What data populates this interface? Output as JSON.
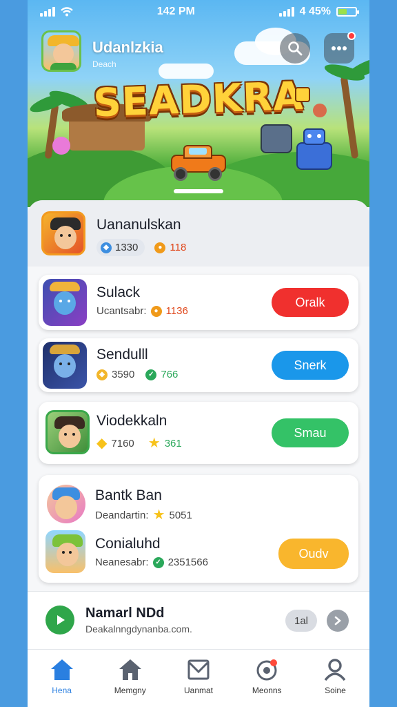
{
  "status_bar": {
    "time": "142 PM",
    "battery": "4 45%",
    "battery_level": 0.45
  },
  "header": {
    "name": "Udanlzkia",
    "subtitle": "Deach"
  },
  "hero": {
    "game_title": "SEADKRA"
  },
  "profile": {
    "name": "Uananulskan",
    "stat1": "1330",
    "stat2": "118"
  },
  "cards": [
    {
      "name": "Sulack",
      "stat_label": "Ucantsabr:",
      "stat_value": "1136",
      "button": "Oralk",
      "button_color": "#f0302e"
    },
    {
      "name": "Sendulll",
      "stat1": "3590",
      "stat2": "766",
      "button": "Snerk",
      "button_color": "#1a97ea"
    },
    {
      "name": "Viodekkaln",
      "stat1": "7160",
      "stat2": "361",
      "button": "Smau",
      "button_color": "#34c267"
    }
  ],
  "group": {
    "entries": [
      {
        "name": "Bantk Ban",
        "stat_label": "Deandartin:",
        "stat_value": "5051"
      },
      {
        "name": "Conialuhd",
        "stat_label": "Neanesabr:",
        "stat_value": "2351566"
      }
    ],
    "button": "Oudv",
    "button_color": "#f9b62d"
  },
  "news": {
    "title": "Namarl NDd",
    "subtitle": "Deakalnngdynanba.com.",
    "badge": "1al"
  },
  "tabs": [
    {
      "label": "Hena",
      "icon": "home-icon"
    },
    {
      "label": "Memgny",
      "icon": "house-icon"
    },
    {
      "label": "Uanmat",
      "icon": "mail-icon"
    },
    {
      "label": "Meonns",
      "icon": "target-icon"
    },
    {
      "label": "Soine",
      "icon": "person-icon"
    }
  ]
}
